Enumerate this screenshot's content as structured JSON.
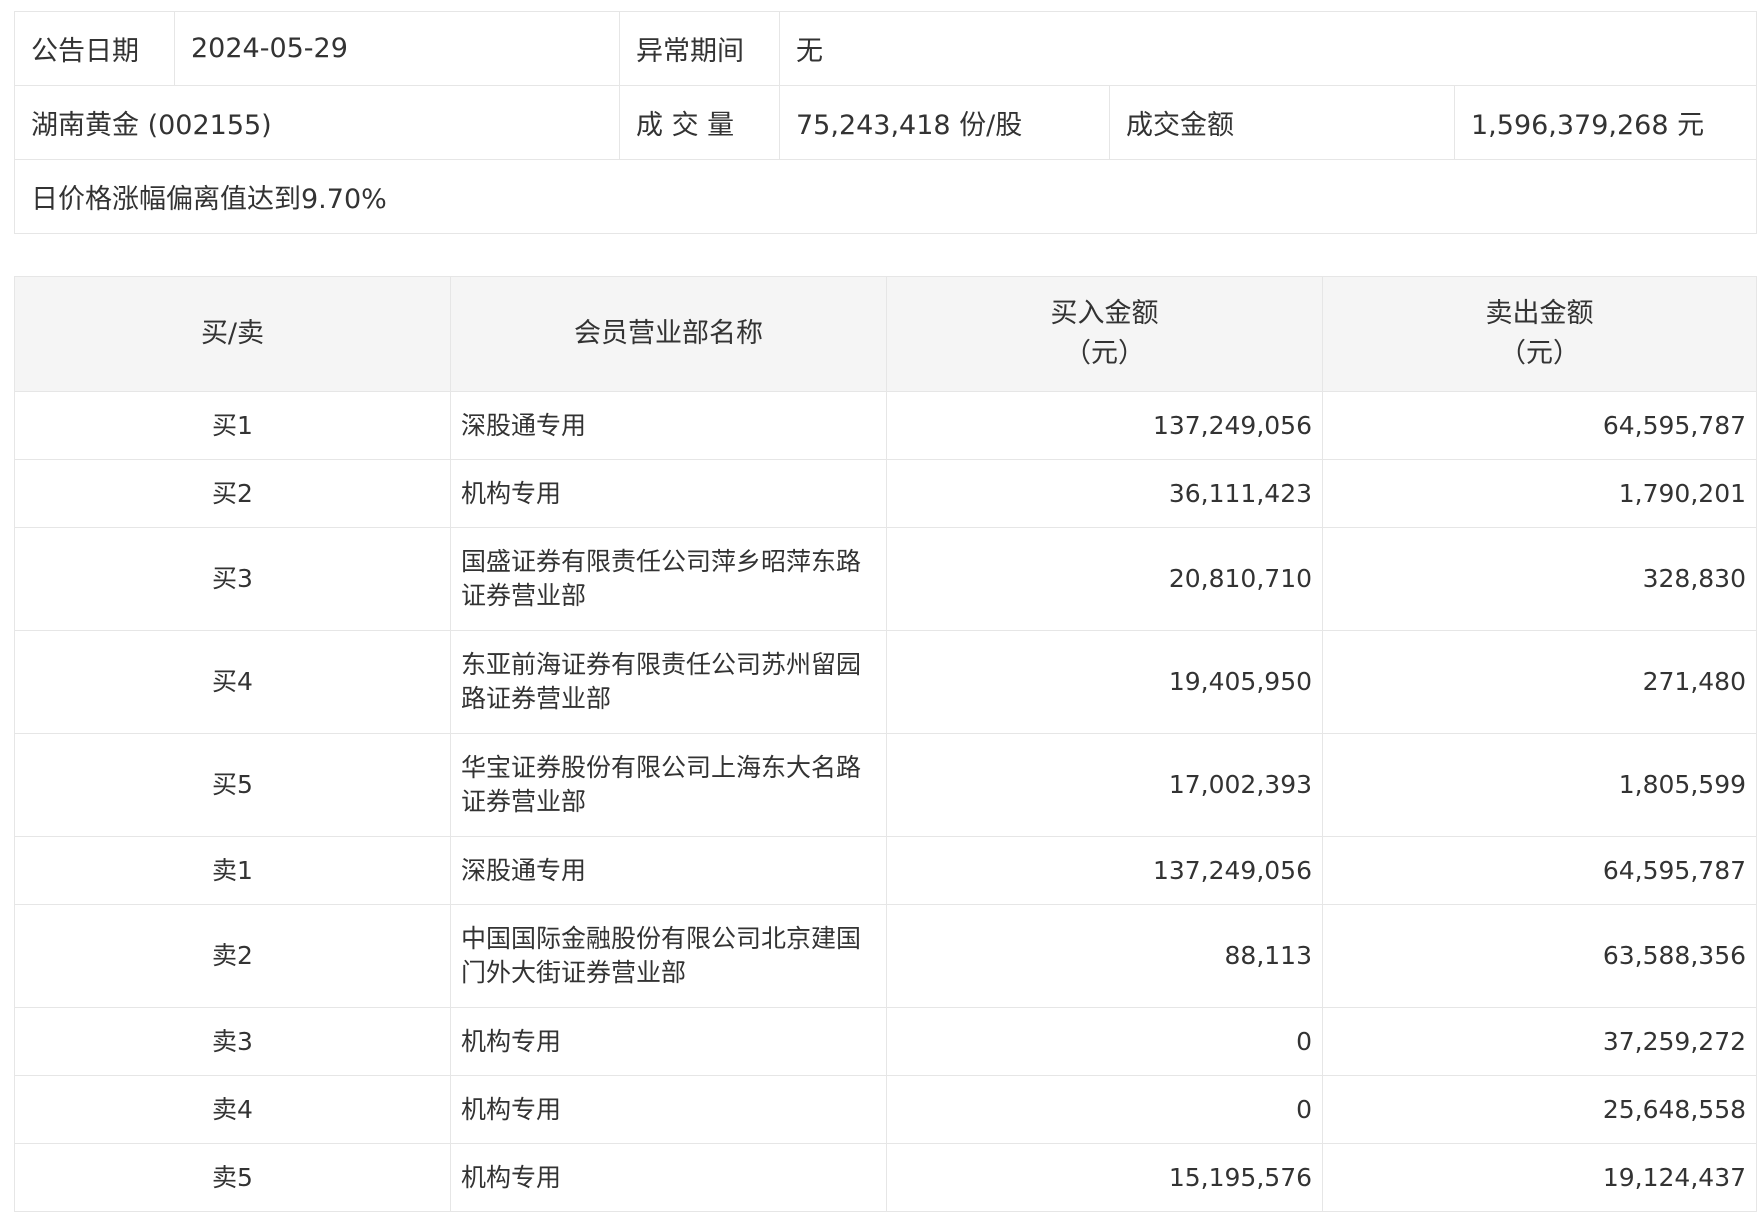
{
  "info": {
    "announce_date_label": "公告日期",
    "announce_date_value": "2024-05-29",
    "abnormal_period_label": "异常期间",
    "abnormal_period_value": "无",
    "stock_name": "湖南黄金 (002155)",
    "volume_label": "成 交 量",
    "volume_value": "75,243,418 份/股",
    "amount_label": "成交金额",
    "amount_value": "1,596,379,268 元",
    "reason": "日价格涨幅偏离值达到9.70%"
  },
  "table": {
    "headers": {
      "side": "买/卖",
      "member": "会员营业部名称",
      "buy_amount": "买入金额",
      "buy_unit": "（元）",
      "sell_amount": "卖出金额",
      "sell_unit": "（元）"
    },
    "rows": [
      {
        "side": "买1",
        "name": "深股通专用",
        "buy": "137,249,056",
        "sell": "64,595,787"
      },
      {
        "side": "买2",
        "name": "机构专用",
        "buy": "36,111,423",
        "sell": "1,790,201"
      },
      {
        "side": "买3",
        "name": "国盛证券有限责任公司萍乡昭萍东路证券营业部",
        "buy": "20,810,710",
        "sell": "328,830"
      },
      {
        "side": "买4",
        "name": "东亚前海证券有限责任公司苏州留园路证券营业部",
        "buy": "19,405,950",
        "sell": "271,480"
      },
      {
        "side": "买5",
        "name": "华宝证券股份有限公司上海东大名路证券营业部",
        "buy": "17,002,393",
        "sell": "1,805,599"
      },
      {
        "side": "卖1",
        "name": "深股通专用",
        "buy": "137,249,056",
        "sell": "64,595,787"
      },
      {
        "side": "卖2",
        "name": "中国国际金融股份有限公司北京建国门外大街证券营业部",
        "buy": "88,113",
        "sell": "63,588,356"
      },
      {
        "side": "卖3",
        "name": "机构专用",
        "buy": "0",
        "sell": "37,259,272"
      },
      {
        "side": "卖4",
        "name": "机构专用",
        "buy": "0",
        "sell": "25,648,558"
      },
      {
        "side": "卖5",
        "name": "机构专用",
        "buy": "15,195,576",
        "sell": "19,124,437"
      }
    ]
  }
}
